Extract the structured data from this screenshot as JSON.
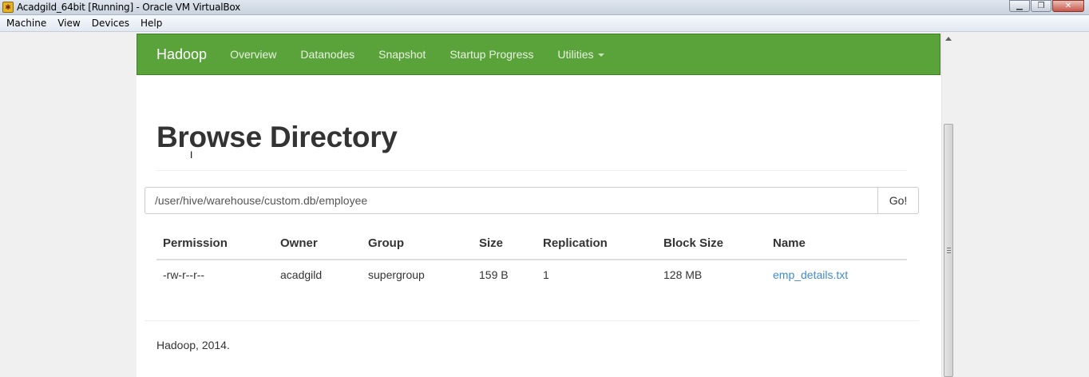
{
  "window": {
    "title": "Acadgild_64bit [Running] - Oracle VM VirtualBox",
    "controls": {
      "minimize": "▁",
      "restore": "❐",
      "close": "✕"
    }
  },
  "menubar": {
    "items": [
      "Machine",
      "View",
      "Devices",
      "Help"
    ]
  },
  "navbar": {
    "brand": "Hadoop",
    "links": [
      "Overview",
      "Datanodes",
      "Snapshot",
      "Startup Progress",
      "Utilities"
    ],
    "color": "#5aa23a"
  },
  "page": {
    "heading": "Browse Directory",
    "path_value": "/user/hive/warehouse/custom.db/employee",
    "go_label": "Go!",
    "footer": "Hadoop, 2014."
  },
  "table": {
    "headers": [
      "Permission",
      "Owner",
      "Group",
      "Size",
      "Replication",
      "Block Size",
      "Name"
    ],
    "rows": [
      [
        "-rw-r--r--",
        "acadgild",
        "supergroup",
        "159 B",
        "1",
        "128 MB",
        "emp_details.txt"
      ]
    ]
  },
  "icons": {
    "app": "virtualbox-icon",
    "utilities_caret": "caret-down-icon",
    "scroll_up": "arrow-up-icon",
    "cursor": "text-cursor-icon"
  }
}
